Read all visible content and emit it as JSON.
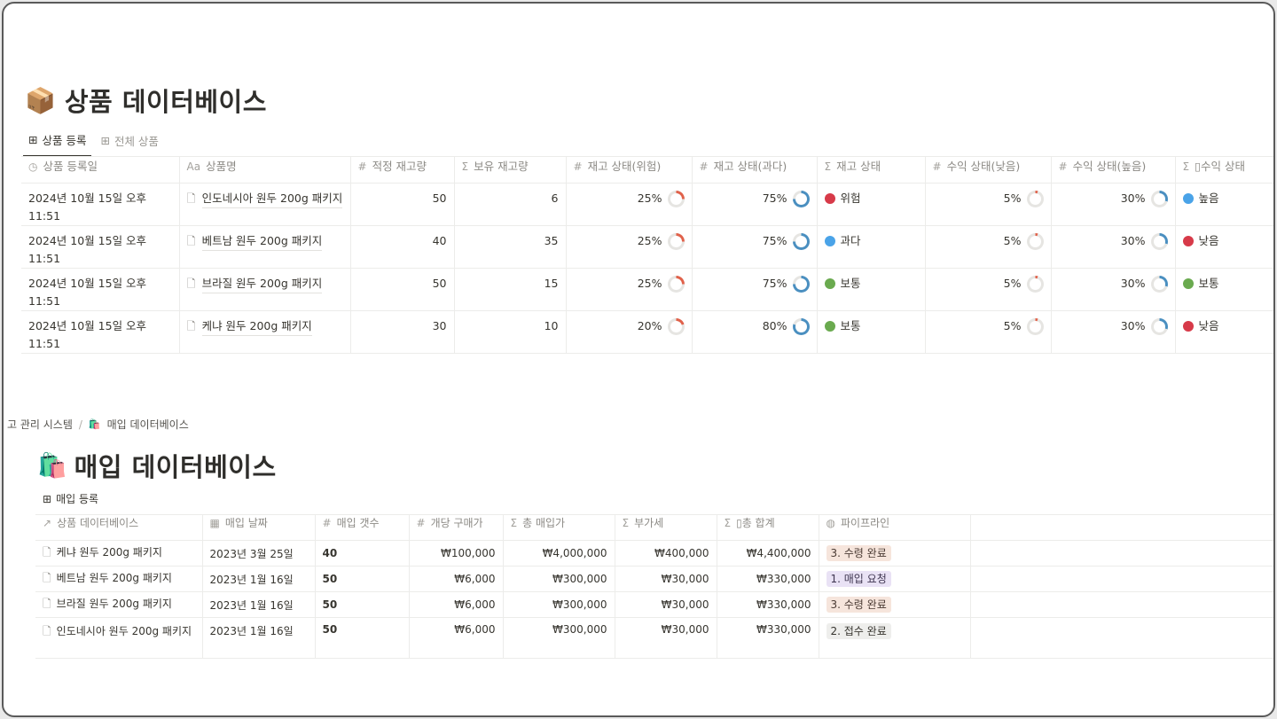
{
  "product_db": {
    "icon": "📦",
    "title": "상품 데이터베이스",
    "tabs": [
      {
        "label": "상품 등록",
        "active": true
      },
      {
        "label": "전체 상품",
        "active": false
      }
    ],
    "columns": [
      {
        "icon": "clock-icon",
        "glyph": "◷",
        "label": "상품 등록일"
      },
      {
        "icon": "text-icon",
        "glyph": "Aa",
        "label": "상품명"
      },
      {
        "icon": "number-icon",
        "glyph": "#",
        "label": "적정 재고량"
      },
      {
        "icon": "sigma-icon",
        "glyph": "Σ",
        "label": "보유 재고량"
      },
      {
        "icon": "number-icon",
        "glyph": "#",
        "label": "재고 상태(위험)"
      },
      {
        "icon": "number-icon",
        "glyph": "#",
        "label": "재고 상태(과다)"
      },
      {
        "icon": "sigma-icon",
        "glyph": "Σ",
        "label": "재고 상태"
      },
      {
        "icon": "number-icon",
        "glyph": "#",
        "label": "수익 상태(낮음)"
      },
      {
        "icon": "number-icon",
        "glyph": "#",
        "label": "수익 상태(높음)"
      },
      {
        "icon": "sigma-icon",
        "glyph": "Σ",
        "label": "▯수익 상태"
      }
    ],
    "rows": [
      {
        "date": "2024년 10월 15일 오후 11:51",
        "name": "인도네시아 원두 200g 패키지",
        "proper": "50",
        "held": "6",
        "risk": "25%",
        "risk_val": 0.25,
        "excess": "75%",
        "excess_val": 0.75,
        "stock_status": "위험",
        "stock_color": "#d73a49",
        "low": "5%",
        "low_val": 0.05,
        "high": "30%",
        "high_val": 0.3,
        "profit_status": "높음",
        "profit_color": "#4aa3e8"
      },
      {
        "date": "2024년 10월 15일 오후 11:51",
        "name": "베트남 원두  200g 패키지",
        "proper": "40",
        "held": "35",
        "risk": "25%",
        "risk_val": 0.25,
        "excess": "75%",
        "excess_val": 0.75,
        "stock_status": "과다",
        "stock_color": "#4aa3e8",
        "low": "5%",
        "low_val": 0.05,
        "high": "30%",
        "high_val": 0.3,
        "profit_status": "낮음",
        "profit_color": "#d73a49"
      },
      {
        "date": "2024년 10월 15일 오후 11:51",
        "name": "브라질 원두 200g 패키지",
        "proper": "50",
        "held": "15",
        "risk": "25%",
        "risk_val": 0.25,
        "excess": "75%",
        "excess_val": 0.75,
        "stock_status": "보통",
        "stock_color": "#6aaa4f",
        "low": "5%",
        "low_val": 0.05,
        "high": "30%",
        "high_val": 0.3,
        "profit_status": "보통",
        "profit_color": "#6aaa4f"
      },
      {
        "date": "2024년 10월 15일 오후 11:51",
        "name": "케냐 원두 200g 패키지",
        "proper": "30",
        "held": "10",
        "risk": "20%",
        "risk_val": 0.2,
        "excess": "80%",
        "excess_val": 0.8,
        "stock_status": "보통",
        "stock_color": "#6aaa4f",
        "low": "5%",
        "low_val": 0.05,
        "high": "30%",
        "high_val": 0.3,
        "profit_status": "낮음",
        "profit_color": "#d73a49"
      }
    ]
  },
  "breadcrumb": {
    "parent": "고 관리 시스템",
    "separator": "/",
    "current_icon": "🛍️",
    "current": "매입 데이터베이스"
  },
  "purchase_db": {
    "icon": "🛍️",
    "title": "매입 데이터베이스",
    "tab": "매입 등록",
    "columns": [
      {
        "icon": "relation-icon",
        "glyph": "↗",
        "label": "상품 데이터베이스"
      },
      {
        "icon": "calendar-icon",
        "glyph": "▦",
        "label": "매입 날짜"
      },
      {
        "icon": "number-icon",
        "glyph": "#",
        "label": "매입 갯수"
      },
      {
        "icon": "number-icon",
        "glyph": "#",
        "label": "개당 구매가"
      },
      {
        "icon": "sigma-icon",
        "glyph": "Σ",
        "label": "총 매입가"
      },
      {
        "icon": "sigma-icon",
        "glyph": "Σ",
        "label": "부가세"
      },
      {
        "icon": "sigma-icon",
        "glyph": "Σ",
        "label": "▯총 합계"
      },
      {
        "icon": "status-icon",
        "glyph": "◍",
        "label": "파이프라인"
      }
    ],
    "rows": [
      {
        "product": "케냐 원두 200g 패키지",
        "date": "2023년 3월 25일",
        "qty": "40",
        "unit": "₩100,000",
        "total": "₩4,000,000",
        "vat": "₩400,000",
        "sum": "₩4,400,000",
        "stage": "3. 수령 완료",
        "stage_bg": "#f6e5dc",
        "stage_fg": "#4a3a33"
      },
      {
        "product": "베트남 원두 200g 패키지",
        "date": "2023년 1월 16일",
        "qty": "50",
        "unit": "₩6,000",
        "total": "₩300,000",
        "vat": "₩30,000",
        "sum": "₩330,000",
        "stage": "1. 매입 요청",
        "stage_bg": "#e9e2f5",
        "stage_fg": "#3e3550"
      },
      {
        "product": "브라질 원두 200g 패키지",
        "date": "2023년 1월 16일",
        "qty": "50",
        "unit": "₩6,000",
        "total": "₩300,000",
        "vat": "₩30,000",
        "sum": "₩330,000",
        "stage": "3. 수령 완료",
        "stage_bg": "#f6e5dc",
        "stage_fg": "#4a3a33"
      },
      {
        "product": "인도네시아 원두 200g 패키지",
        "date": "2023년 1월 16일",
        "qty": "50",
        "unit": "₩6,000",
        "total": "₩300,000",
        "vat": "₩30,000",
        "sum": "₩330,000",
        "stage": "2. 접수 완료",
        "stage_bg": "#eeeeec",
        "stage_fg": "#37352f"
      }
    ]
  },
  "colors": {
    "ring_red": "#e0614a",
    "ring_blue": "#4a8fc0",
    "ring_track": "#e6e5e2"
  }
}
